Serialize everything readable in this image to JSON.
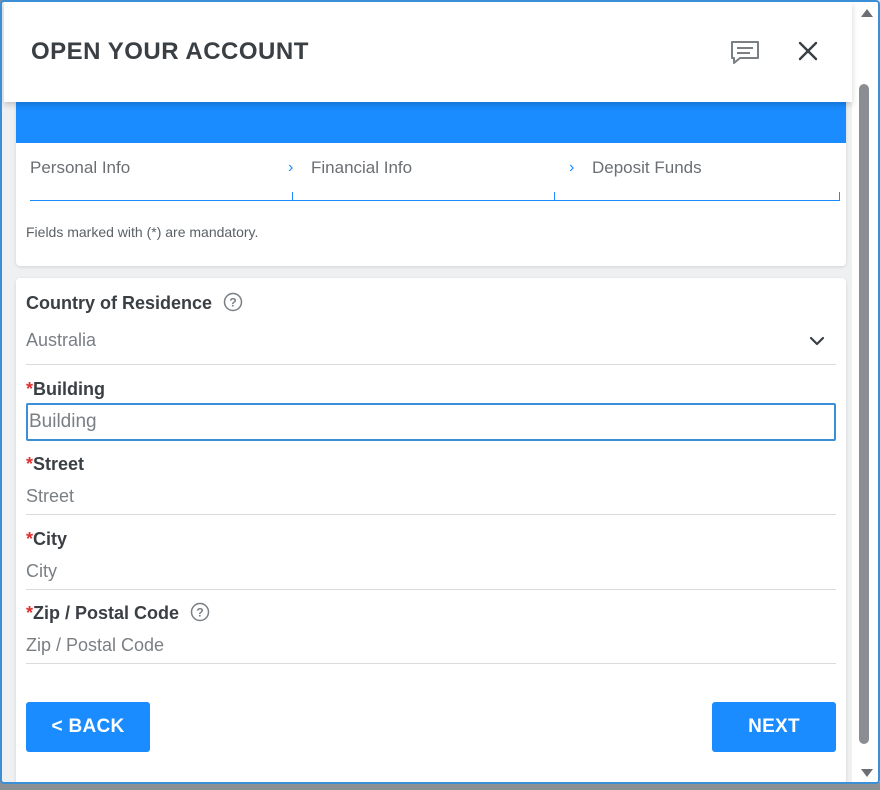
{
  "window": {
    "title": "OPEN YOUR ACCOUNT",
    "accent_color": "#1a8cff",
    "required_color": "#e0302f"
  },
  "icons": {
    "chat": "chat-icon",
    "close": "close-icon",
    "help": "help-icon",
    "dropdown": "chevron-down-icon",
    "step_separator": "chevron-right-icon"
  },
  "steps": [
    {
      "label": "Personal Info"
    },
    {
      "label": "Financial Info"
    },
    {
      "label": "Deposit Funds"
    }
  ],
  "step_separator": "›",
  "mandatory_note": "Fields marked with (*) are mandatory.",
  "form": {
    "required_mark": "*",
    "country": {
      "label": "Country of Residence",
      "value": "Australia"
    },
    "building": {
      "label": "Building",
      "placeholder": "Building"
    },
    "street": {
      "label": "Street",
      "placeholder": "Street"
    },
    "city": {
      "label": "City",
      "placeholder": "City"
    },
    "zip": {
      "label": "Zip / Postal Code",
      "placeholder": "Zip / Postal Code"
    }
  },
  "buttons": {
    "back": "< BACK",
    "next": "NEXT"
  }
}
